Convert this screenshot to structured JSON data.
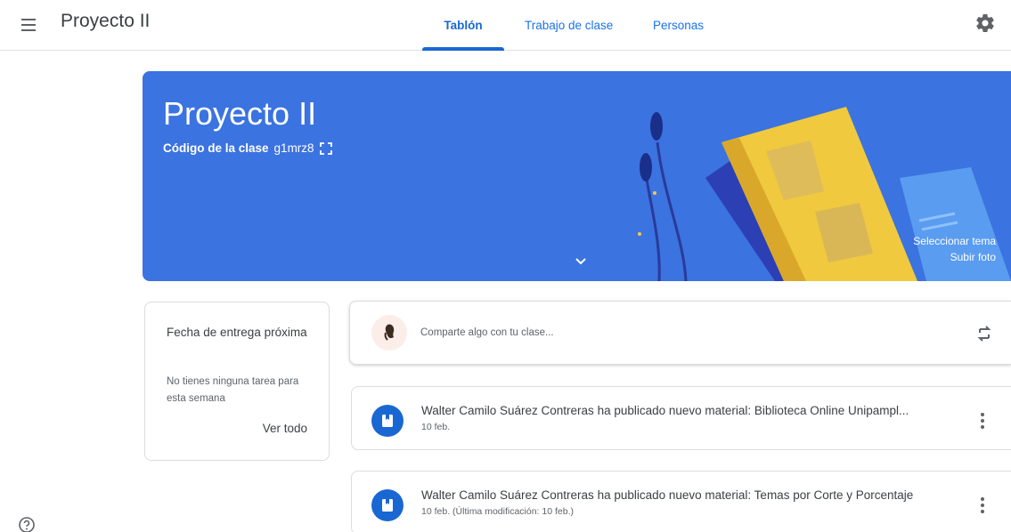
{
  "header": {
    "title": "Proyecto II",
    "tabs": [
      {
        "label": "Tablón",
        "active": true
      },
      {
        "label": "Trabajo de clase",
        "active": false
      },
      {
        "label": "Personas",
        "active": false
      }
    ],
    "icons": {
      "menu": "hamburger-menu-icon",
      "settings": "gear-icon"
    }
  },
  "banner": {
    "title": "Proyecto II",
    "code_label": "Código de la clase",
    "code_value": "g1mrz8",
    "select_theme": "Seleccionar tema",
    "upload_photo": "Subir foto",
    "color": "#3b73e0"
  },
  "upcoming": {
    "title": "Fecha de entrega próxima",
    "empty": "No tienes ninguna tarea para esta semana",
    "link": "Ver todo"
  },
  "share": {
    "placeholder": "Comparte algo con tu clase..."
  },
  "posts": [
    {
      "title": "Walter Camilo Suárez Contreras ha publicado nuevo material: Biblioteca Online Unipampl...",
      "date": "10 feb."
    },
    {
      "title": "Walter Camilo Suárez Contreras ha publicado nuevo material: Temas por Corte y Porcentaje",
      "date": "10 feb. (Última modificación: 10 feb.)"
    }
  ],
  "colors": {
    "accent": "#1967d2",
    "border": "#dadce0"
  }
}
